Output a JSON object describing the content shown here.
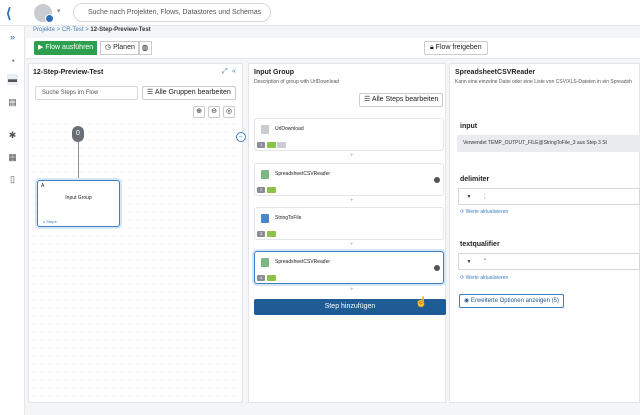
{
  "header": {
    "search_placeholder": "Suche nach Projekten, Flows, Datastores und Schemas"
  },
  "breadcrumb": {
    "projects": "Projekte",
    "sep1": ">",
    "project": "CR-Test",
    "sep2": ">",
    "flow": "12-Step-Preview-Test"
  },
  "toolbar": {
    "run_label": "Flow ausführen",
    "plan_label": "Planen",
    "release_label": "Flow freigeben"
  },
  "flow_panel": {
    "title": "12-Step-Preview-Test",
    "search_placeholder": "Suche Steps im Flow",
    "edit_groups_label": "Alle Gruppen bearbeiten",
    "start_label": "0",
    "group_node_label": "Input Group",
    "group_node_letter": "A",
    "group_node_steps": "4 Steps"
  },
  "group_panel": {
    "title": "Input Group",
    "subtitle": "Description of group with UrlDownload",
    "edit_steps_label": "Alle Steps bearbeiten",
    "steps": [
      {
        "name": "UrlDownload",
        "num": "1"
      },
      {
        "name": "SpreadsheetCSVReader",
        "num": "2"
      },
      {
        "name": "StringToFile",
        "num": "3"
      },
      {
        "name": "SpreadsheetCSVReader",
        "num": "4"
      }
    ],
    "add_step_label": "Step hinzufügen"
  },
  "detail_panel": {
    "title": "SpreadsheetCSVReader",
    "subtitle": "Kann eine einzelne Datei oder eine Liste von CSV/XLS-Dateien in ein Spreadsh",
    "input_label": "input",
    "input_value": "Verwendet TEMP_OUTPUT_FILE@StringToFile_3 aus Step 3 St",
    "delimiter_label": "delimiter",
    "delimiter_value": ";",
    "refresh_label": "Werte aktualisieren",
    "textqualifier_label": "textqualifier",
    "textqualifier_value": "\"",
    "advanced_label": "Erweiterte Optionen anzeigen (5)"
  }
}
